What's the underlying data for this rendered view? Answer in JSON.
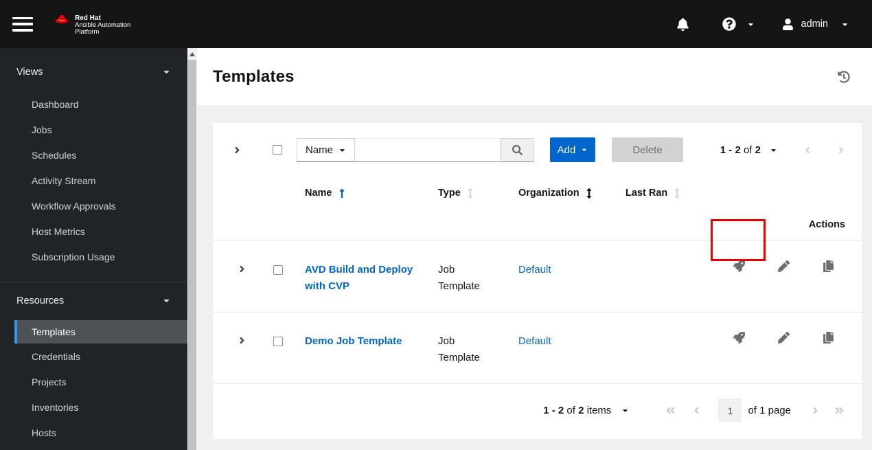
{
  "masthead": {
    "brand": {
      "name": "Red Hat",
      "product_line1": "Ansible Automation",
      "product_line2": "Platform"
    },
    "user_menu": {
      "username": "admin"
    }
  },
  "sidebar": {
    "groups": [
      {
        "label": "Views",
        "items": [
          "Dashboard",
          "Jobs",
          "Schedules",
          "Activity Stream",
          "Workflow Approvals",
          "Host Metrics",
          "Subscription Usage"
        ]
      },
      {
        "label": "Resources",
        "items": [
          "Templates",
          "Credentials",
          "Projects",
          "Inventories",
          "Hosts"
        ],
        "active_item": "Templates"
      }
    ]
  },
  "page": {
    "title": "Templates"
  },
  "toolbar": {
    "filter": {
      "selected": "Name"
    },
    "search": {
      "value": ""
    },
    "buttons": {
      "add": "Add",
      "delete": "Delete"
    },
    "pagination": {
      "range": "1 - 2",
      "of_label": "of",
      "total": "2"
    }
  },
  "table": {
    "headers": {
      "name": "Name",
      "type": "Type",
      "organization": "Organization",
      "last_ran": "Last Ran",
      "actions": "Actions"
    },
    "sort": {
      "sorted_by": "Name",
      "direction": "ascending"
    },
    "rows": [
      {
        "name": "AVD Build and Deploy with CVP",
        "type": "Job Template",
        "organization": "Default",
        "last_ran": ""
      },
      {
        "name": "Demo Job Template",
        "type": "Job Template",
        "organization": "Default",
        "last_ran": ""
      }
    ]
  },
  "footer_pagination": {
    "range": "1 - 2",
    "of_label": "of",
    "total": "2",
    "items_label": "items",
    "current_page": "1",
    "page_label": "of 1 page"
  },
  "icons": {
    "row_actions": [
      "launch-rocket-icon",
      "edit-pencil-icon",
      "copy-icon"
    ],
    "header_action": "history-icon"
  },
  "colors": {
    "masthead_bg": "#151515",
    "sidebar_bg": "#212427",
    "active_nav_bg": "#4f5255",
    "active_nav_border": "#2b9af3",
    "link_blue": "#0066cc",
    "primary_button": "#0066cc",
    "disabled_button_bg": "#d2d2d2",
    "highlight_annotation": "#ee0000",
    "page_bg": "#f0f0f0"
  }
}
